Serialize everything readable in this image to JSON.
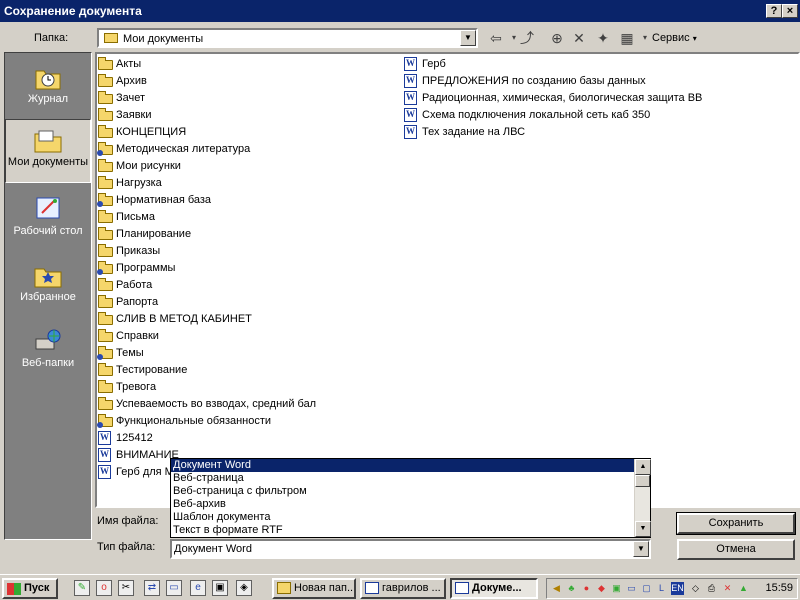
{
  "window": {
    "title": "Сохранение документа",
    "help_label": "?",
    "close_label": "×"
  },
  "toolbar": {
    "folder_label": "Папка:",
    "folder_value": "Мои документы",
    "tools_label": "Сервис"
  },
  "places": [
    {
      "label": "Журнал",
      "icon": "history-icon"
    },
    {
      "label": "Мои документы",
      "icon": "my-documents-icon"
    },
    {
      "label": "Рабочий стол",
      "icon": "desktop-icon"
    },
    {
      "label": "Избранное",
      "icon": "favorites-icon"
    },
    {
      "label": "Веб-папки",
      "icon": "web-folders-icon"
    }
  ],
  "files_col1": [
    {
      "name": "Акты",
      "type": "folder"
    },
    {
      "name": "Архив",
      "type": "folder"
    },
    {
      "name": "Зачет",
      "type": "folder"
    },
    {
      "name": "Заявки",
      "type": "folder"
    },
    {
      "name": "КОНЦЕПЦИЯ",
      "type": "folder"
    },
    {
      "name": "Методическая литература",
      "type": "folder-linked"
    },
    {
      "name": "Мои рисунки",
      "type": "folder"
    },
    {
      "name": "Нагрузка",
      "type": "folder"
    },
    {
      "name": "Нормативная база",
      "type": "folder-linked"
    },
    {
      "name": "Письма",
      "type": "folder"
    },
    {
      "name": "Планирование",
      "type": "folder"
    },
    {
      "name": "Приказы",
      "type": "folder"
    },
    {
      "name": "Программы",
      "type": "folder-linked"
    },
    {
      "name": "Работа",
      "type": "folder"
    },
    {
      "name": "Рапорта",
      "type": "folder"
    },
    {
      "name": "СЛИВ В МЕТОД КАБИНЕТ",
      "type": "folder"
    },
    {
      "name": "Справки",
      "type": "folder"
    },
    {
      "name": "Темы",
      "type": "folder-linked"
    },
    {
      "name": "Тестирование",
      "type": "folder"
    },
    {
      "name": "Тревога",
      "type": "folder"
    },
    {
      "name": "Успеваемость во взводах, средний бал",
      "type": "folder"
    },
    {
      "name": "Функциональные обязанности",
      "type": "folder-linked"
    },
    {
      "name": "125412",
      "type": "doc"
    },
    {
      "name": "ВНИМАНИЕ",
      "type": "doc"
    },
    {
      "name": "Герб для М",
      "type": "doc"
    }
  ],
  "files_col2": [
    {
      "name": "Герб",
      "type": "doc"
    },
    {
      "name": "ПРЕДЛОЖЕНИЯ по созданию базы данных",
      "type": "doc"
    },
    {
      "name": "Радиоционная, химическая, биологическая защита ВВ",
      "type": "doc"
    },
    {
      "name": "Схема подключения локальной сеть каб 350",
      "type": "doc"
    },
    {
      "name": "Тех задание на ЛВС",
      "type": "doc"
    }
  ],
  "form": {
    "filename_label": "Имя файла:",
    "filetype_label": "Тип файла:",
    "filetype_value": "Документ Word",
    "filetype_options": [
      "Документ Word",
      "Веб-страница",
      "Веб-страница с фильтром",
      "Веб-архив",
      "Шаблон документа",
      "Текст в формате RTF"
    ],
    "save_label": "Сохранить",
    "cancel_label": "Отмена"
  },
  "taskbar": {
    "start_label": "Пуск",
    "tasks": [
      {
        "label": "Новая пап...",
        "active": false
      },
      {
        "label": "гаврилов ...",
        "active": false
      },
      {
        "label": "Докуме...",
        "active": true
      }
    ],
    "language": "EN",
    "clock": "15:59"
  }
}
